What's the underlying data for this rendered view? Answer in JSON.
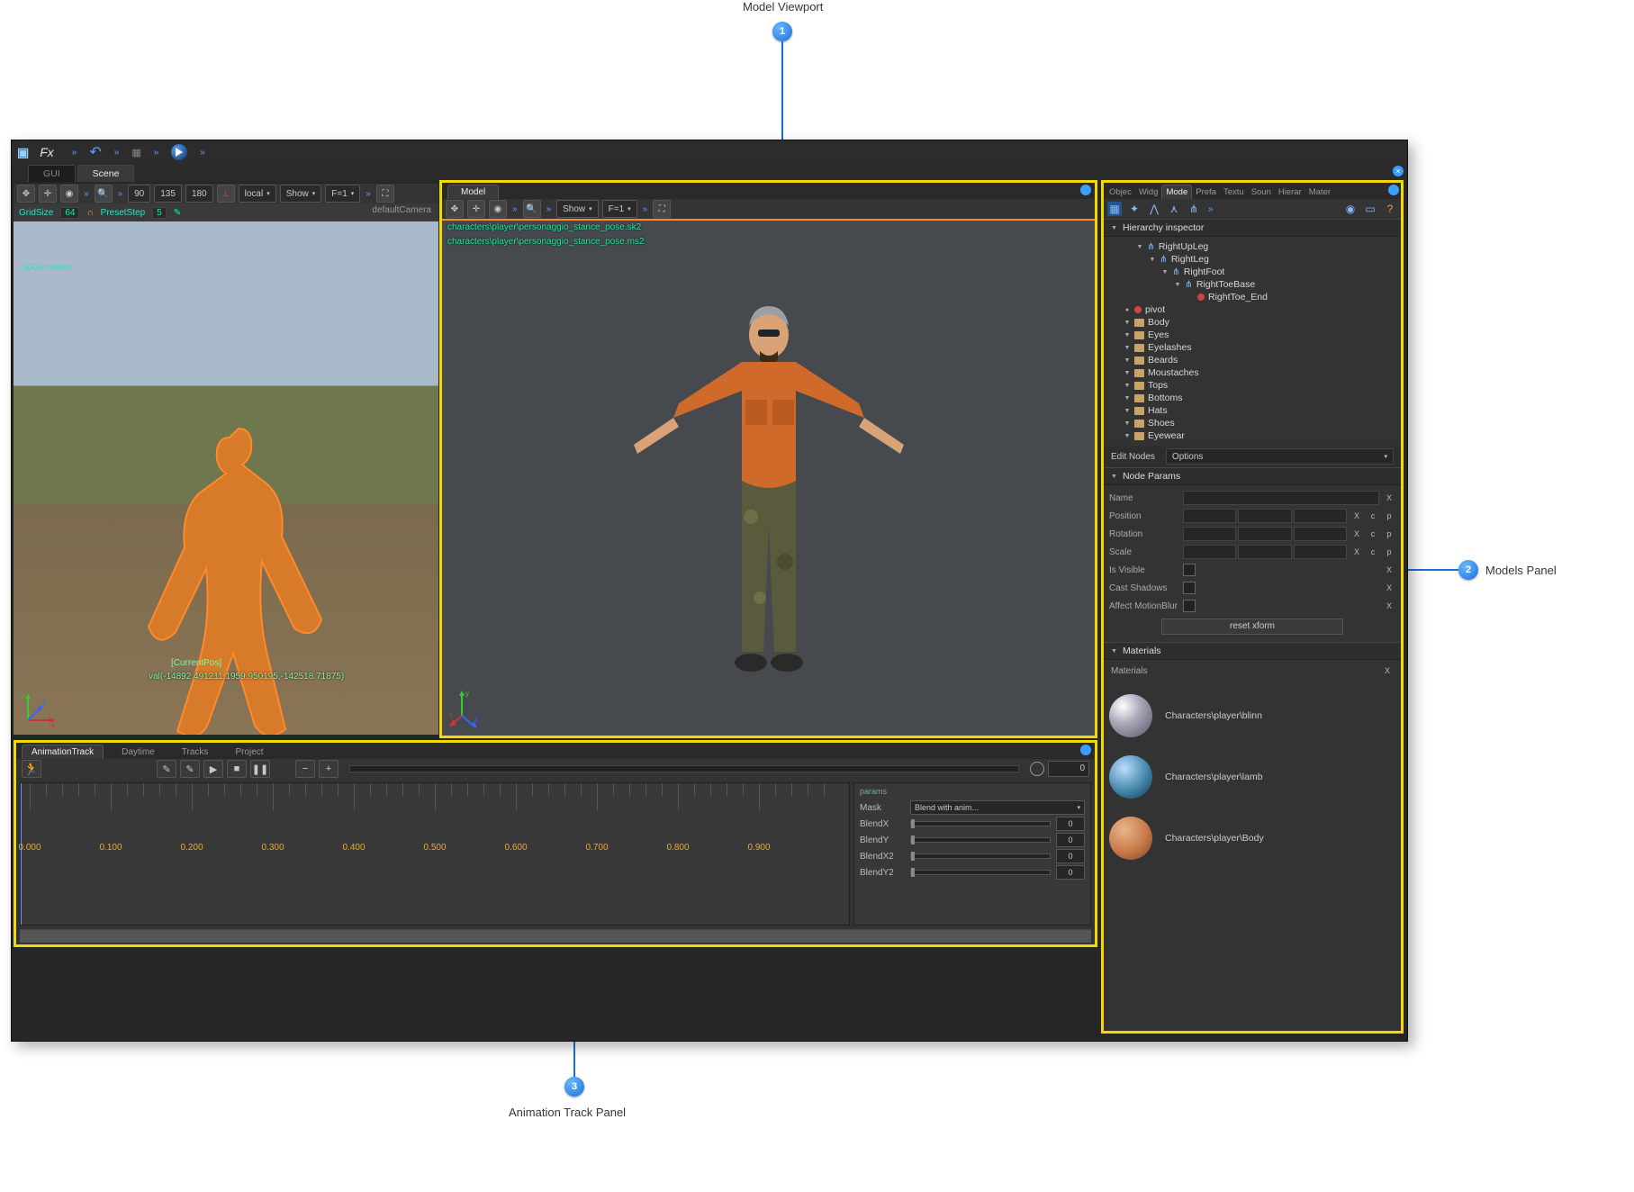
{
  "callouts": {
    "c1": "Model Viewport",
    "c2": "Models Panel",
    "c3": "Animation Track Panel"
  },
  "topbar": {
    "fx": "Fx"
  },
  "main_tabs": {
    "gui": "GUI",
    "scene": "Scene"
  },
  "scene_tb": {
    "angles": [
      "90",
      "135",
      "180"
    ],
    "space": "local",
    "show": "Show",
    "fmt": "F=1"
  },
  "scene_grid": {
    "gridsize_label": "GridSize",
    "gridsize_val": "64",
    "preset_label": "PresetStep",
    "preset_val": "5"
  },
  "scene_overlay": {
    "dist": "5000 meters",
    "current": "[CurrentPos]",
    "pos": "val(-14892.491211,1959.950195,-142518.71875)",
    "cam": "defaultCamera"
  },
  "model_tab": "Model",
  "model_tb": {
    "show": "Show",
    "fmt": "F=1"
  },
  "model_paths": {
    "p1": "characters\\player\\personaggio_stance_pose.sk2",
    "p2": "characters\\player\\personaggio_stance_pose.ms2"
  },
  "right_tabs": [
    "Objec",
    "Widg",
    "Mode",
    "Prefa",
    "Textu",
    "Soun",
    "Hierar",
    "Mater"
  ],
  "right_active": "Mode",
  "hierarchy_hdr": "Hierarchy inspector",
  "tree": [
    {
      "d": 2,
      "ic": "joint",
      "t": "RightUpLeg",
      "e": "▼"
    },
    {
      "d": 3,
      "ic": "joint",
      "t": "RightLeg",
      "e": "▼"
    },
    {
      "d": 4,
      "ic": "joint",
      "t": "RightFoot",
      "e": "▼"
    },
    {
      "d": 5,
      "ic": "joint",
      "t": "RightToeBase",
      "e": "▼"
    },
    {
      "d": 6,
      "ic": "dot",
      "t": "RightToe_End",
      "e": ""
    },
    {
      "d": 1,
      "ic": "dot",
      "t": "pivot",
      "e": "●"
    },
    {
      "d": 1,
      "ic": "mesh",
      "t": "Body",
      "e": "▼"
    },
    {
      "d": 1,
      "ic": "mesh",
      "t": "Eyes",
      "e": "▼"
    },
    {
      "d": 1,
      "ic": "mesh",
      "t": "Eyelashes",
      "e": "▼"
    },
    {
      "d": 1,
      "ic": "mesh",
      "t": "Beards",
      "e": "▼"
    },
    {
      "d": 1,
      "ic": "mesh",
      "t": "Moustaches",
      "e": "▼"
    },
    {
      "d": 1,
      "ic": "mesh",
      "t": "Tops",
      "e": "▼"
    },
    {
      "d": 1,
      "ic": "mesh",
      "t": "Bottoms",
      "e": "▼"
    },
    {
      "d": 1,
      "ic": "mesh",
      "t": "Hats",
      "e": "▼"
    },
    {
      "d": 1,
      "ic": "mesh",
      "t": "Shoes",
      "e": "▼"
    },
    {
      "d": 1,
      "ic": "mesh",
      "t": "Eyewear",
      "e": "▼"
    }
  ],
  "edit_nodes": {
    "lbl": "Edit Nodes",
    "opt": "Options"
  },
  "node_params_hdr": "Node Params",
  "node_params": {
    "name": "Name",
    "position": "Position",
    "rotation": "Rotation",
    "scale": "Scale",
    "isvisible": "Is Visible",
    "cast": "Cast Shadows",
    "motionblur": "Affect MotionBlur",
    "reset": "reset xform",
    "x": "X",
    "c": "c",
    "p": "p"
  },
  "materials_hdr": "Materials",
  "materials_lbl": "Materials",
  "materials": [
    {
      "name": "Characters\\player\\blinn"
    },
    {
      "name": "Characters\\player\\lamb"
    },
    {
      "name": "Characters\\player\\Body"
    }
  ],
  "anim_tabs": [
    "AnimationTrack",
    "Daytime",
    "Tracks",
    "Project"
  ],
  "anim_tb": {
    "time": "0"
  },
  "timeline_labels": [
    "0.000",
    "0.100",
    "0.200",
    "0.300",
    "0.400",
    "0.500",
    "0.600",
    "0.700",
    "0.800",
    "0.900"
  ],
  "params": {
    "hdr": "params",
    "mask": "Mask",
    "mask_val": "Blend with anim...",
    "blendx": "BlendX",
    "blendy": "BlendY",
    "blendx2": "BlendX2",
    "blendy2": "BlendY2",
    "zero": "0"
  }
}
